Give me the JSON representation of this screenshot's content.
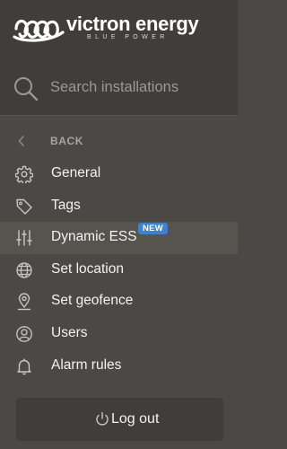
{
  "brand": {
    "name": "victron energy",
    "tagline": "BLUE POWER",
    "logo_icon": "victron-swirl-logo"
  },
  "search": {
    "placeholder": "Search installations",
    "value": "",
    "icon": "search-icon"
  },
  "back": {
    "label": "BACK",
    "icon": "chevron-left-icon"
  },
  "menu": {
    "items": [
      {
        "label": "General",
        "icon": "gear-icon"
      },
      {
        "label": "Tags",
        "icon": "tag-icon"
      },
      {
        "label": "Dynamic ESS",
        "icon": "sliders-icon",
        "badge": "NEW",
        "active": true
      },
      {
        "label": "Set location",
        "icon": "globe-icon"
      },
      {
        "label": "Set geofence",
        "icon": "map-pin-icon"
      },
      {
        "label": "Users",
        "icon": "user-icon"
      },
      {
        "label": "Alarm rules",
        "icon": "bell-icon"
      }
    ]
  },
  "logout": {
    "label": "Log out",
    "icon": "power-icon"
  },
  "colors": {
    "background": "#4a4945",
    "panel": "#3f3e3b",
    "active_row": "#55544f",
    "badge": "#3e83c9",
    "text": "#f2f2ef"
  }
}
